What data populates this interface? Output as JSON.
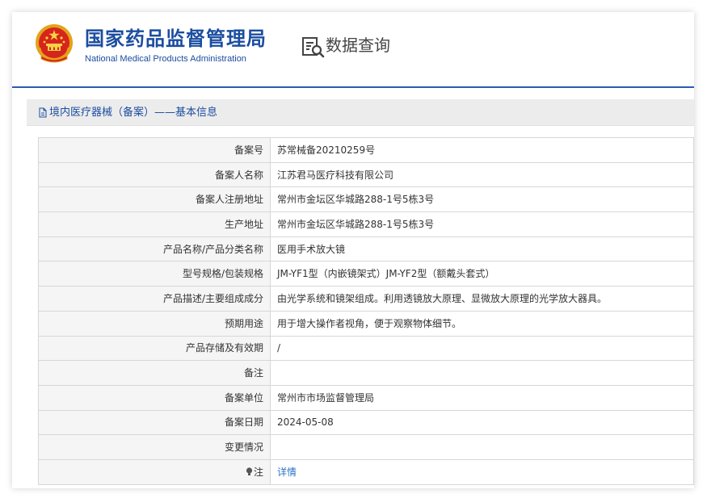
{
  "header": {
    "site_title": "国家药品监督管理局",
    "site_subtitle": "National Medical Products Administration",
    "query_title": "数据查询",
    "accent_color": "#1b4da0",
    "emblem_icon": "national-emblem-icon",
    "query_icon": "search-document-icon"
  },
  "panel": {
    "title": "境内医疗器械（备案）——基本信息",
    "title_icon": "document-icon"
  },
  "rows": [
    {
      "label": "备案号",
      "value": "苏常械备20210259号"
    },
    {
      "label": "备案人名称",
      "value": "江苏君马医疗科技有限公司"
    },
    {
      "label": "备案人注册地址",
      "value": "常州市金坛区华城路288-1号5栋3号"
    },
    {
      "label": "生产地址",
      "value": "常州市金坛区华城路288-1号5栋3号"
    },
    {
      "label": "产品名称/产品分类名称",
      "value": "医用手术放大镜"
    },
    {
      "label": "型号规格/包装规格",
      "value": "JM-YF1型（内嵌镜架式）JM-YF2型（额戴头套式）"
    },
    {
      "label": "产品描述/主要组成成分",
      "value": "由光学系统和镜架组成。利用透镜放大原理、显微放大原理的光学放大器具。"
    },
    {
      "label": "预期用途",
      "value": "用于增大操作者视角，便于观察物体细节。"
    },
    {
      "label": "产品存储及有效期",
      "value": "/"
    },
    {
      "label": "备注",
      "value": ""
    },
    {
      "label": "备案单位",
      "value": "常州市市场监督管理局"
    },
    {
      "label": "备案日期",
      "value": "2024-05-08"
    },
    {
      "label": "变更情况",
      "value": ""
    }
  ],
  "note_row": {
    "label": "注",
    "icon": "lightbulb-icon",
    "link_text": "详情"
  }
}
